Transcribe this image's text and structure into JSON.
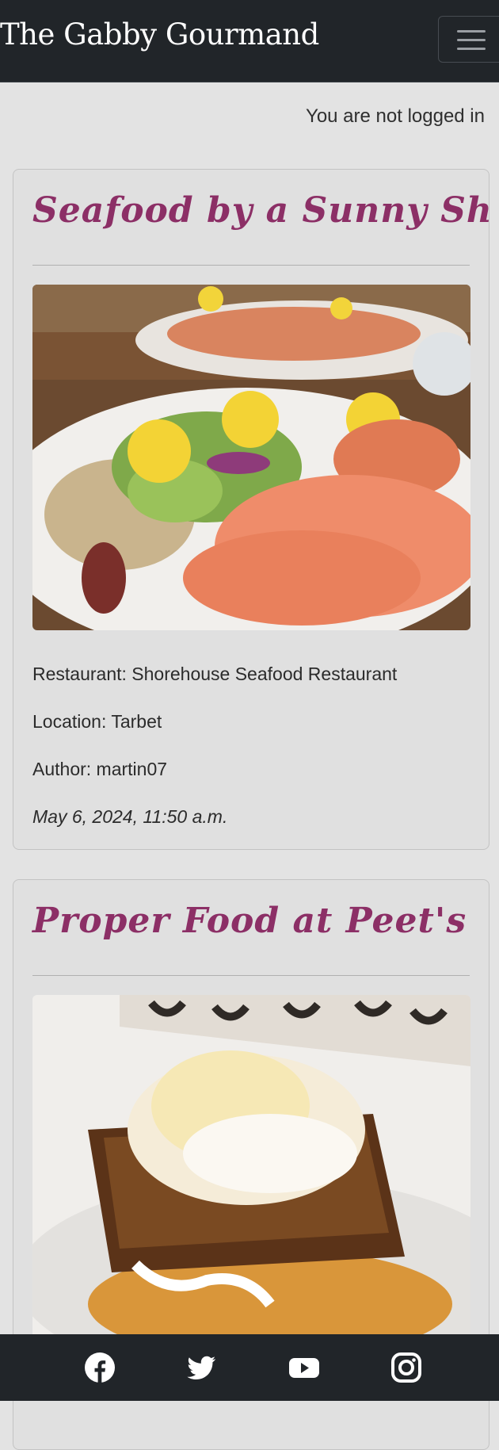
{
  "navbar": {
    "brand": "The Gabby Gourmand",
    "toggle_icon": "hamburger-icon"
  },
  "login_status": "You are not logged in",
  "posts": [
    {
      "title": "Seafood by a Sunny Shore",
      "image_icon": "seafood-platter-photo",
      "restaurant": "Restaurant: Shorehouse Seafood Restaurant",
      "location": "Location: Tarbet",
      "author": "Author: martin07",
      "date": "May 6, 2024, 11:50 a.m."
    },
    {
      "title": "Proper Food at Peet's",
      "image_icon": "sticky-toffee-pudding-photo"
    }
  ],
  "footer": {
    "social": [
      {
        "icon": "facebook-icon"
      },
      {
        "icon": "twitter-icon"
      },
      {
        "icon": "youtube-icon"
      },
      {
        "icon": "instagram-icon"
      }
    ]
  },
  "colors": {
    "navbar_bg": "#212529",
    "page_bg": "#e3e3e3",
    "card_bg": "#e0e0e0",
    "title_accent": "#8c2f66"
  }
}
